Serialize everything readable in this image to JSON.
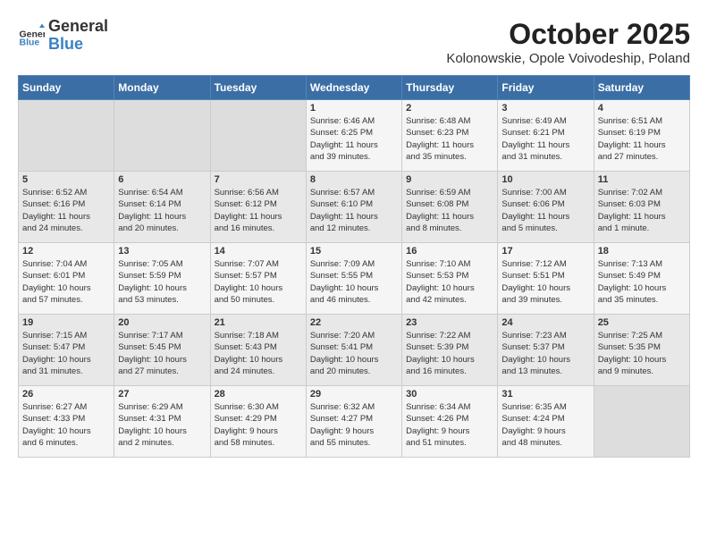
{
  "logo": {
    "general": "General",
    "blue": "Blue"
  },
  "title": "October 2025",
  "location": "Kolonowskie, Opole Voivodeship, Poland",
  "weekdays": [
    "Sunday",
    "Monday",
    "Tuesday",
    "Wednesday",
    "Thursday",
    "Friday",
    "Saturday"
  ],
  "rows": [
    [
      {
        "day": "",
        "info": ""
      },
      {
        "day": "",
        "info": ""
      },
      {
        "day": "",
        "info": ""
      },
      {
        "day": "1",
        "info": "Sunrise: 6:46 AM\nSunset: 6:25 PM\nDaylight: 11 hours\nand 39 minutes."
      },
      {
        "day": "2",
        "info": "Sunrise: 6:48 AM\nSunset: 6:23 PM\nDaylight: 11 hours\nand 35 minutes."
      },
      {
        "day": "3",
        "info": "Sunrise: 6:49 AM\nSunset: 6:21 PM\nDaylight: 11 hours\nand 31 minutes."
      },
      {
        "day": "4",
        "info": "Sunrise: 6:51 AM\nSunset: 6:19 PM\nDaylight: 11 hours\nand 27 minutes."
      }
    ],
    [
      {
        "day": "5",
        "info": "Sunrise: 6:52 AM\nSunset: 6:16 PM\nDaylight: 11 hours\nand 24 minutes."
      },
      {
        "day": "6",
        "info": "Sunrise: 6:54 AM\nSunset: 6:14 PM\nDaylight: 11 hours\nand 20 minutes."
      },
      {
        "day": "7",
        "info": "Sunrise: 6:56 AM\nSunset: 6:12 PM\nDaylight: 11 hours\nand 16 minutes."
      },
      {
        "day": "8",
        "info": "Sunrise: 6:57 AM\nSunset: 6:10 PM\nDaylight: 11 hours\nand 12 minutes."
      },
      {
        "day": "9",
        "info": "Sunrise: 6:59 AM\nSunset: 6:08 PM\nDaylight: 11 hours\nand 8 minutes."
      },
      {
        "day": "10",
        "info": "Sunrise: 7:00 AM\nSunset: 6:06 PM\nDaylight: 11 hours\nand 5 minutes."
      },
      {
        "day": "11",
        "info": "Sunrise: 7:02 AM\nSunset: 6:03 PM\nDaylight: 11 hours\nand 1 minute."
      }
    ],
    [
      {
        "day": "12",
        "info": "Sunrise: 7:04 AM\nSunset: 6:01 PM\nDaylight: 10 hours\nand 57 minutes."
      },
      {
        "day": "13",
        "info": "Sunrise: 7:05 AM\nSunset: 5:59 PM\nDaylight: 10 hours\nand 53 minutes."
      },
      {
        "day": "14",
        "info": "Sunrise: 7:07 AM\nSunset: 5:57 PM\nDaylight: 10 hours\nand 50 minutes."
      },
      {
        "day": "15",
        "info": "Sunrise: 7:09 AM\nSunset: 5:55 PM\nDaylight: 10 hours\nand 46 minutes."
      },
      {
        "day": "16",
        "info": "Sunrise: 7:10 AM\nSunset: 5:53 PM\nDaylight: 10 hours\nand 42 minutes."
      },
      {
        "day": "17",
        "info": "Sunrise: 7:12 AM\nSunset: 5:51 PM\nDaylight: 10 hours\nand 39 minutes."
      },
      {
        "day": "18",
        "info": "Sunrise: 7:13 AM\nSunset: 5:49 PM\nDaylight: 10 hours\nand 35 minutes."
      }
    ],
    [
      {
        "day": "19",
        "info": "Sunrise: 7:15 AM\nSunset: 5:47 PM\nDaylight: 10 hours\nand 31 minutes."
      },
      {
        "day": "20",
        "info": "Sunrise: 7:17 AM\nSunset: 5:45 PM\nDaylight: 10 hours\nand 27 minutes."
      },
      {
        "day": "21",
        "info": "Sunrise: 7:18 AM\nSunset: 5:43 PM\nDaylight: 10 hours\nand 24 minutes."
      },
      {
        "day": "22",
        "info": "Sunrise: 7:20 AM\nSunset: 5:41 PM\nDaylight: 10 hours\nand 20 minutes."
      },
      {
        "day": "23",
        "info": "Sunrise: 7:22 AM\nSunset: 5:39 PM\nDaylight: 10 hours\nand 16 minutes."
      },
      {
        "day": "24",
        "info": "Sunrise: 7:23 AM\nSunset: 5:37 PM\nDaylight: 10 hours\nand 13 minutes."
      },
      {
        "day": "25",
        "info": "Sunrise: 7:25 AM\nSunset: 5:35 PM\nDaylight: 10 hours\nand 9 minutes."
      }
    ],
    [
      {
        "day": "26",
        "info": "Sunrise: 6:27 AM\nSunset: 4:33 PM\nDaylight: 10 hours\nand 6 minutes."
      },
      {
        "day": "27",
        "info": "Sunrise: 6:29 AM\nSunset: 4:31 PM\nDaylight: 10 hours\nand 2 minutes."
      },
      {
        "day": "28",
        "info": "Sunrise: 6:30 AM\nSunset: 4:29 PM\nDaylight: 9 hours\nand 58 minutes."
      },
      {
        "day": "29",
        "info": "Sunrise: 6:32 AM\nSunset: 4:27 PM\nDaylight: 9 hours\nand 55 minutes."
      },
      {
        "day": "30",
        "info": "Sunrise: 6:34 AM\nSunset: 4:26 PM\nDaylight: 9 hours\nand 51 minutes."
      },
      {
        "day": "31",
        "info": "Sunrise: 6:35 AM\nSunset: 4:24 PM\nDaylight: 9 hours\nand 48 minutes."
      },
      {
        "day": "",
        "info": ""
      }
    ]
  ]
}
